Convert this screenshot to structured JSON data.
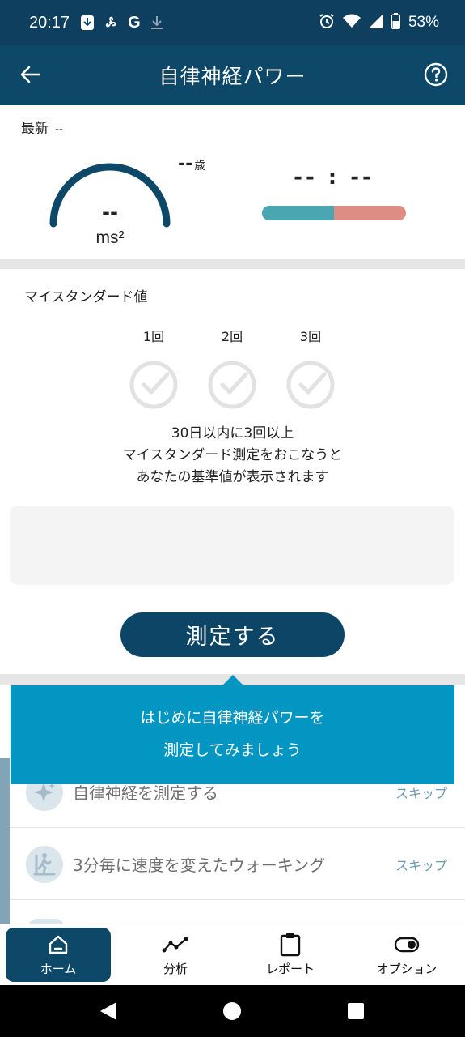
{
  "status_bar": {
    "time": "20:17",
    "battery": "53%",
    "icons": [
      "download-box-icon",
      "fan-icon",
      "google-icon",
      "download-icon",
      "alarm-icon",
      "wifi-icon",
      "signal-icon",
      "battery-icon"
    ]
  },
  "header": {
    "title": "自律神経パワー",
    "back_icon": "arrow-left-icon",
    "help_icon": "question-circle-icon"
  },
  "latest": {
    "label": "最新",
    "date": "--",
    "power_value": "--",
    "power_unit": "ms²",
    "age_value": "--",
    "age_unit": "歳",
    "balance_text": "-- : --",
    "balance_ratio": 0.5,
    "colors": {
      "gauge": "#0e4868",
      "balance_left": "#4aa7b1",
      "balance_right": "#de8d85"
    }
  },
  "my_standard": {
    "title": "マイスタンダード値",
    "counts": [
      "1回",
      "2回",
      "3回"
    ],
    "info_lines": [
      "30日以内に3回以上",
      "マイスタンダード測定をおこなうと",
      "あなたの基準値が表示されます"
    ],
    "measure_button": "測定する"
  },
  "tooltip": {
    "lines": [
      "はじめに自律神経パワーを",
      "測定してみましょう"
    ]
  },
  "tasks": [
    {
      "label": "自律神経を測定する",
      "skip": "スキップ",
      "icon": "sparkle-icon"
    },
    {
      "label": "3分毎に速度を変えたウォーキング",
      "skip": "スキップ",
      "icon": "treadmill-icon"
    }
  ],
  "bottom_nav": [
    {
      "label": "ホーム",
      "icon": "home-icon",
      "active": true
    },
    {
      "label": "分析",
      "icon": "analysis-icon",
      "active": false
    },
    {
      "label": "レポート",
      "icon": "clipboard-icon",
      "active": false
    },
    {
      "label": "オプション",
      "icon": "toggle-icon",
      "active": false
    }
  ]
}
